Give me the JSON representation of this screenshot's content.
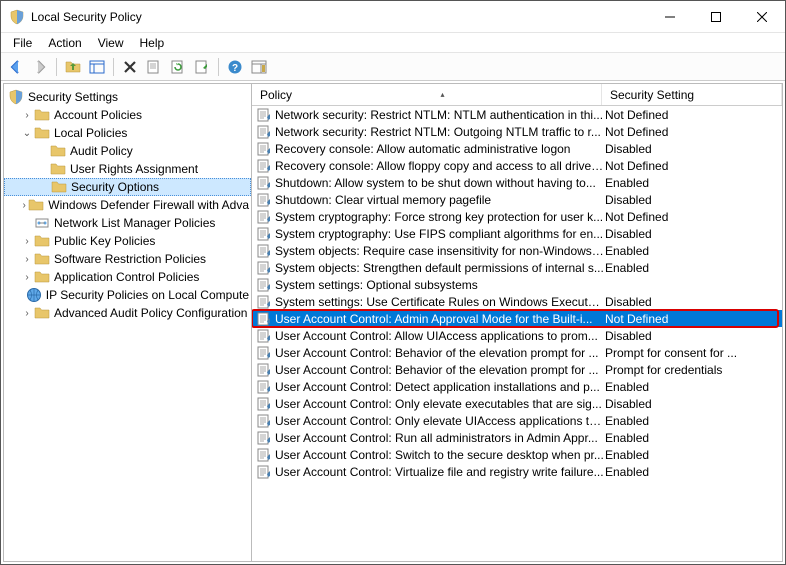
{
  "window": {
    "title": "Local Security Policy"
  },
  "menus": {
    "file": "File",
    "action": "Action",
    "view": "View",
    "help": "Help"
  },
  "tree": {
    "root": "Security Settings",
    "nodes": [
      {
        "label": "Account Policies",
        "depth": 1,
        "expandable": true,
        "expanded": false,
        "icon": "folder"
      },
      {
        "label": "Local Policies",
        "depth": 1,
        "expandable": true,
        "expanded": true,
        "icon": "folder"
      },
      {
        "label": "Audit Policy",
        "depth": 2,
        "expandable": false,
        "expanded": false,
        "icon": "folder"
      },
      {
        "label": "User Rights Assignment",
        "depth": 2,
        "expandable": false,
        "expanded": false,
        "icon": "folder"
      },
      {
        "label": "Security Options",
        "depth": 2,
        "expandable": false,
        "expanded": false,
        "icon": "folder",
        "selected": true
      },
      {
        "label": "Windows Defender Firewall with Adva",
        "depth": 1,
        "expandable": true,
        "expanded": false,
        "icon": "folder"
      },
      {
        "label": "Network List Manager Policies",
        "depth": 1,
        "expandable": false,
        "expanded": false,
        "icon": "nlm"
      },
      {
        "label": "Public Key Policies",
        "depth": 1,
        "expandable": true,
        "expanded": false,
        "icon": "folder"
      },
      {
        "label": "Software Restriction Policies",
        "depth": 1,
        "expandable": true,
        "expanded": false,
        "icon": "folder"
      },
      {
        "label": "Application Control Policies",
        "depth": 1,
        "expandable": true,
        "expanded": false,
        "icon": "folder"
      },
      {
        "label": "IP Security Policies on Local Compute",
        "depth": 1,
        "expandable": false,
        "expanded": false,
        "icon": "ipsec"
      },
      {
        "label": "Advanced Audit Policy Configuration",
        "depth": 1,
        "expandable": true,
        "expanded": false,
        "icon": "folder"
      }
    ]
  },
  "list": {
    "headers": {
      "policy": "Policy",
      "setting": "Security Setting"
    },
    "rows": [
      {
        "policy": "Network security: Restrict NTLM: NTLM authentication in thi...",
        "setting": "Not Defined"
      },
      {
        "policy": "Network security: Restrict NTLM: Outgoing NTLM traffic to r...",
        "setting": "Not Defined"
      },
      {
        "policy": "Recovery console: Allow automatic administrative logon",
        "setting": "Disabled"
      },
      {
        "policy": "Recovery console: Allow floppy copy and access to all drives...",
        "setting": "Not Defined"
      },
      {
        "policy": "Shutdown: Allow system to be shut down without having to...",
        "setting": "Enabled"
      },
      {
        "policy": "Shutdown: Clear virtual memory pagefile",
        "setting": "Disabled"
      },
      {
        "policy": "System cryptography: Force strong key protection for user k...",
        "setting": "Not Defined"
      },
      {
        "policy": "System cryptography: Use FIPS compliant algorithms for en...",
        "setting": "Disabled"
      },
      {
        "policy": "System objects: Require case insensitivity for non-Windows ...",
        "setting": "Enabled"
      },
      {
        "policy": "System objects: Strengthen default permissions of internal s...",
        "setting": "Enabled"
      },
      {
        "policy": "System settings: Optional subsystems",
        "setting": ""
      },
      {
        "policy": "System settings: Use Certificate Rules on Windows Executab...",
        "setting": "Disabled"
      },
      {
        "policy": "User Account Control: Admin Approval Mode for the Built-i...",
        "setting": "Not Defined",
        "selected": true,
        "highlighted": true
      },
      {
        "policy": "User Account Control: Allow UIAccess applications to prom...",
        "setting": "Disabled"
      },
      {
        "policy": "User Account Control: Behavior of the elevation prompt for ...",
        "setting": "Prompt for consent for ..."
      },
      {
        "policy": "User Account Control: Behavior of the elevation prompt for ...",
        "setting": "Prompt for credentials"
      },
      {
        "policy": "User Account Control: Detect application installations and p...",
        "setting": "Enabled"
      },
      {
        "policy": "User Account Control: Only elevate executables that are sig...",
        "setting": "Disabled"
      },
      {
        "policy": "User Account Control: Only elevate UIAccess applications th...",
        "setting": "Enabled"
      },
      {
        "policy": "User Account Control: Run all administrators in Admin Appr...",
        "setting": "Enabled"
      },
      {
        "policy": "User Account Control: Switch to the secure desktop when pr...",
        "setting": "Enabled"
      },
      {
        "policy": "User Account Control: Virtualize file and registry write failure...",
        "setting": "Enabled"
      }
    ]
  }
}
